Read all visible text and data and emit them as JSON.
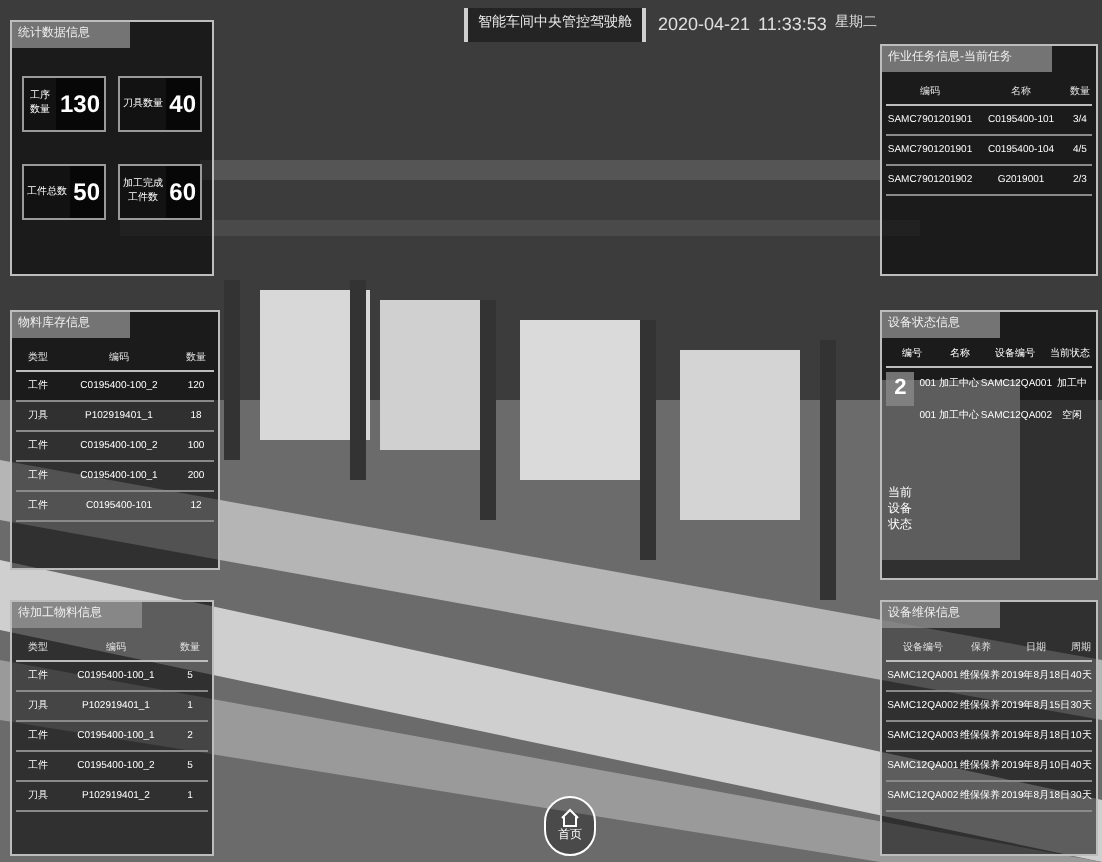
{
  "header": {
    "title": "智能车间中央管控驾驶舱",
    "date": "2020-04-21",
    "time": "11:33:53",
    "weekday": "星期二"
  },
  "stats_panel": {
    "title": "统计数据信息",
    "stats": [
      {
        "label": "工序数量",
        "value": "130"
      },
      {
        "label": "刀具数量",
        "value": "40"
      },
      {
        "label": "工件总数",
        "value": "50"
      },
      {
        "label": "加工完成工件数",
        "value": "60"
      }
    ]
  },
  "left_middle": {
    "title": "物料库存信息",
    "columns": [
      "类型",
      "编码",
      "数量"
    ],
    "rows": [
      [
        "工件",
        "C0195400-100_2",
        "120"
      ],
      [
        "刀具",
        "P102919401_1",
        "18"
      ],
      [
        "工件",
        "C0195400-100_2",
        "100"
      ],
      [
        "工件",
        "C0195400-100_1",
        "200"
      ],
      [
        "工件",
        "C0195400-101",
        "12"
      ]
    ]
  },
  "left_bottom": {
    "title": "待加工物料信息",
    "columns": [
      "类型",
      "编码",
      "数量"
    ],
    "rows": [
      [
        "工件",
        "C0195400-100_1",
        "5"
      ],
      [
        "刀具",
        "P102919401_1",
        "1"
      ],
      [
        "工件",
        "C0195400-100_1",
        "2"
      ],
      [
        "工件",
        "C0195400-100_2",
        "5"
      ],
      [
        "刀具",
        "P102919401_2",
        "1"
      ]
    ]
  },
  "right_top": {
    "title": "作业任务信息-当前任务",
    "columns": [
      "编码",
      "名称",
      "数量"
    ],
    "rows": [
      [
        "SAMC7901201901",
        "C0195400-101",
        "3/4"
      ],
      [
        "SAMC7901201901",
        "C0195400-104",
        "4/5"
      ],
      [
        "SAMC7901201902",
        "G2019001",
        "2/3"
      ]
    ]
  },
  "right_middle": {
    "title": "设备状态信息",
    "columns": [
      "编号",
      "名称",
      "设备编号",
      "当前状态"
    ],
    "rows": [
      [
        "001",
        "加工中心",
        "SAMC12QA001",
        "加工中"
      ],
      [
        "001",
        "加工中心",
        "SAMC12QA002",
        "空闲"
      ]
    ],
    "badge": "2",
    "caption": "当前设备状态"
  },
  "right_bottom": {
    "title": "设备维保信息",
    "columns": [
      "设备编号",
      "保养",
      "日期",
      "周期"
    ],
    "rows": [
      [
        "SAMC12QA001",
        "维保保养",
        "2019年8月18日",
        "40天"
      ],
      [
        "SAMC12QA002",
        "维保保养",
        "2019年8月15日",
        "30天"
      ],
      [
        "SAMC12QA003",
        "维保保养",
        "2019年8月18日",
        "10天"
      ],
      [
        "SAMC12QA001",
        "维保保养",
        "2019年8月10日",
        "40天"
      ],
      [
        "SAMC12QA002",
        "维保保养",
        "2019年8月18日",
        "30天"
      ]
    ]
  },
  "home_button": {
    "label": "首页"
  }
}
